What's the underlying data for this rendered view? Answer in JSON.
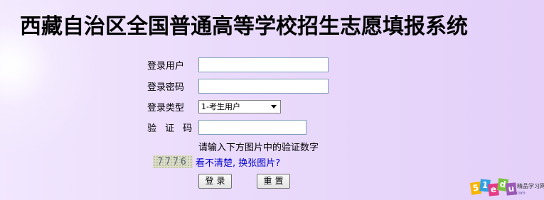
{
  "page": {
    "title": "西藏自治区全国普通高等学校招生志愿填报系统"
  },
  "login_form": {
    "username_label": "登录用户",
    "username_value": "",
    "password_label": "登录密码",
    "password_value": "",
    "type_label": "登录类型",
    "type_selected": "1-考生用户",
    "captcha_label": "验 证 码",
    "captcha_value": "",
    "captcha_hint": "请输入下方图片中的验证数字",
    "captcha_image_text": "7776",
    "refresh_link": "看不清楚, 换张图片?",
    "login_button": "登录",
    "reset_button": "重置"
  },
  "watermark": {
    "letters": [
      "5",
      "1",
      "e",
      "d",
      "u"
    ],
    "letter_colors": [
      "#f7b500",
      "#35a0e0",
      "#e63a86",
      "#7cc242",
      "#9b59b6"
    ],
    "site_text": "精品学习网",
    "domain_suffix": ".com"
  }
}
